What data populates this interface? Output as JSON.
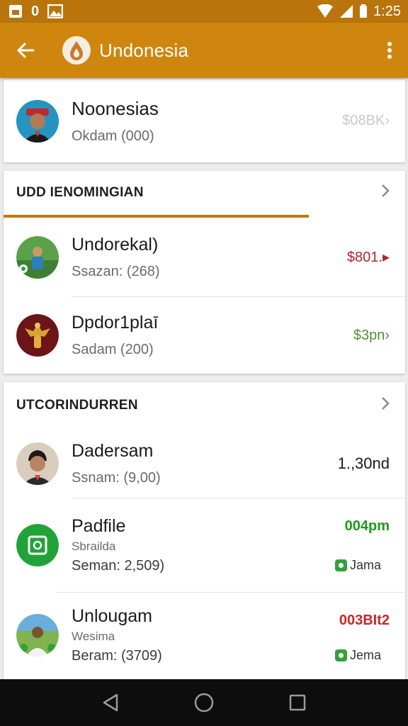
{
  "status_bar": {
    "left_icons": [
      "notification-icon",
      "sim-icon",
      "image-icon"
    ],
    "sim_label": "0",
    "time": "1:25"
  },
  "app_bar": {
    "title": "Undonesia",
    "back_icon": "back-arrow-icon",
    "menu_icon": "more-vert-icon"
  },
  "profile": {
    "title": "Noonesias",
    "subtitle": "Okdam (000)",
    "value": "$08BK›"
  },
  "section1": {
    "title": "UDD IENOMINGIAN",
    "items": [
      {
        "title": "Undorekal)",
        "subtitle": "Ssazan: (268)",
        "value": "$801.▸",
        "value_color": "#b5242c"
      },
      {
        "title": "Dpdor1plaī",
        "subtitle": "Sadam (200)",
        "value": "$3pn›",
        "value_color": "#4e8f3a"
      }
    ]
  },
  "section2": {
    "title": "UTCORINDURREN",
    "items": [
      {
        "title": "Dadersam",
        "subtitle": "Ssnam: (9,00)",
        "value": "1.,30nd",
        "value_color": "#1a1a1a"
      },
      {
        "title": "Padfile",
        "subtitle_small": "Sbrailda",
        "subtitle": "Seman: 2,509)",
        "value": "004pm",
        "value_color": "#1f9a1f",
        "badge": "Jama"
      },
      {
        "title": "Unlougam",
        "subtitle_small": "Wesima",
        "subtitle": "Beram: (3709)",
        "value": "003BIt2",
        "value_color": "#c62828",
        "badge": "Jema"
      }
    ]
  },
  "nav_bar": {
    "icons": [
      "back-triangle-icon",
      "home-circle-icon",
      "recents-square-icon"
    ]
  },
  "colors": {
    "status_bar": "#b9740b",
    "app_bar": "#cf860f",
    "accent_line": "#c9770e",
    "green": "#2fa339"
  }
}
